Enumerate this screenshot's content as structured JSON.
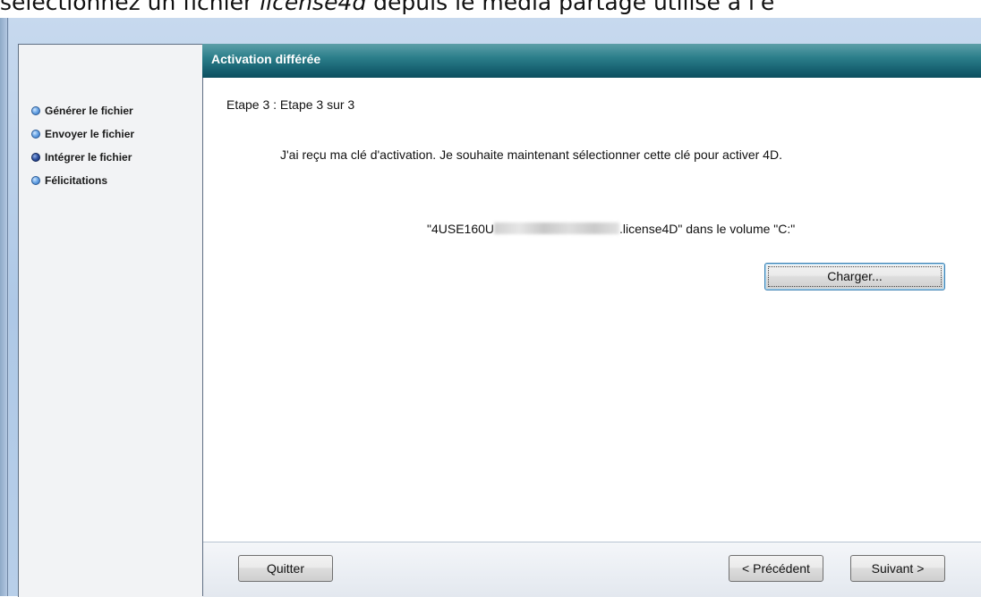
{
  "caption": {
    "before": "sélectionnez un fichier ",
    "italic": "license4d",
    "after": " depuis le média partagé utilisé à l'é"
  },
  "panel": {
    "title": "Activation différée"
  },
  "steps": [
    {
      "label": "Générer le fichier",
      "active": false
    },
    {
      "label": "Envoyer le fichier",
      "active": false
    },
    {
      "label": "Intégrer le fichier",
      "active": true
    },
    {
      "label": "Félicitations",
      "active": false
    }
  ],
  "content": {
    "step_text": "Etape 3 : Etape 3 sur 3",
    "instruction": "J'ai reçu ma clé d'activation. Je souhaite maintenant sélectionner cette clé pour activer 4D.",
    "file_prefix": "\"4USE160U",
    "file_suffix": ".license4D\" dans le volume \"C:\""
  },
  "buttons": {
    "load": "Charger...",
    "quit": "Quitter",
    "previous": "< Précédent",
    "next": "Suivant >"
  }
}
